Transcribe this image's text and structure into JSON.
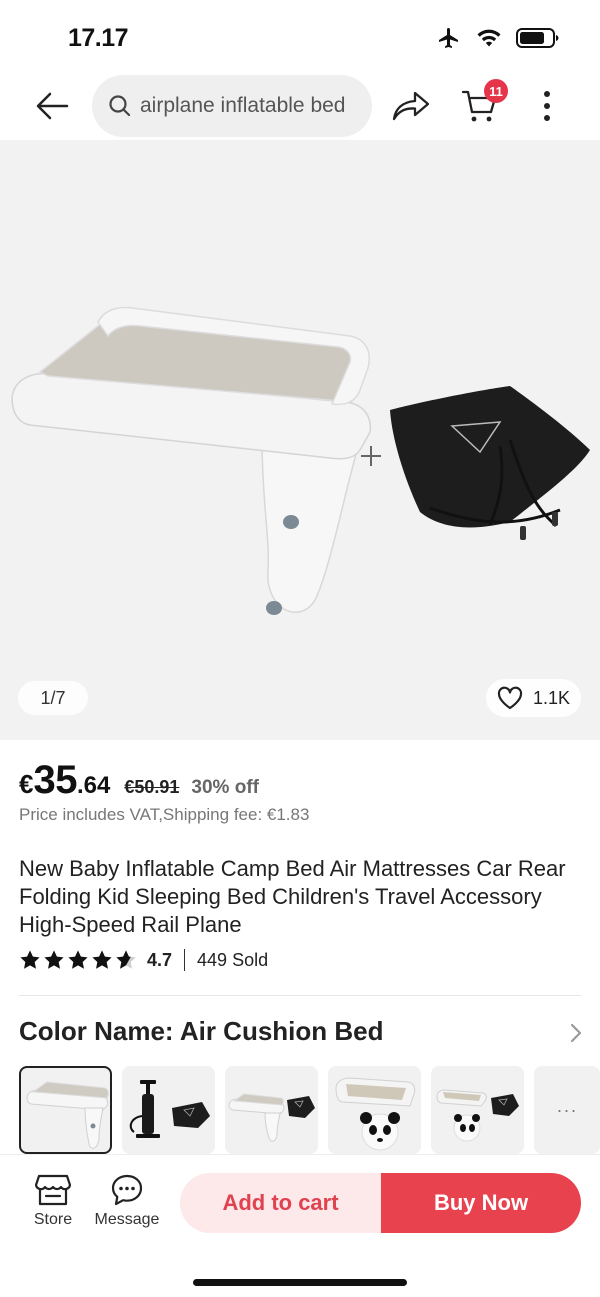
{
  "status": {
    "time": "17.17"
  },
  "header": {
    "search_text": "airplane inflatable bed",
    "cart_count": "11"
  },
  "gallery": {
    "counter": "1/7",
    "favorites": "1.1K"
  },
  "price": {
    "currency": "€",
    "integer": "35",
    "decimal": ".64",
    "original": "€50.91",
    "discount": "30% off",
    "vat_note": "Price includes VAT,Shipping fee: €1.83"
  },
  "product": {
    "title": "New Baby Inflatable Camp Bed Air Mattresses Car Rear Folding Kid Sleeping Bed Children's Travel Accessory High-Speed Rail Plane",
    "rating": "4.7",
    "rating_stars": 4.7,
    "sold": "449 Sold"
  },
  "variants": {
    "label": "Color Name: Air Cushion Bed",
    "more": "···"
  },
  "bottom": {
    "store_label": "Store",
    "message_label": "Message",
    "add_to_cart": "Add to cart",
    "buy_now": "Buy Now"
  },
  "colors": {
    "accent": "#e8424f",
    "accent_light": "#fde8ea",
    "badge": "#e6344a"
  }
}
